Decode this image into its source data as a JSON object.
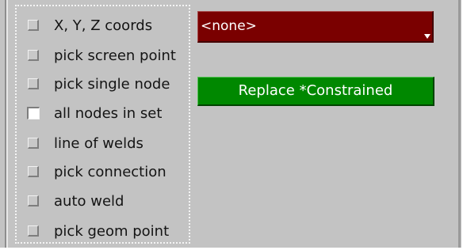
{
  "options": [
    {
      "label": "X, Y, Z coords",
      "checked": false
    },
    {
      "label": "pick screen point",
      "checked": false
    },
    {
      "label": "pick single node",
      "checked": false
    },
    {
      "label": "all nodes in set",
      "checked": true
    },
    {
      "label": "line of welds",
      "checked": false
    },
    {
      "label": "pick connection",
      "checked": false
    },
    {
      "label": "auto weld",
      "checked": false
    },
    {
      "label": "pick geom point",
      "checked": false
    }
  ],
  "dropdown": {
    "value": "<none>",
    "color": "#7a0000"
  },
  "replace_button": {
    "label": "Replace *Constrained",
    "color": "#008800"
  },
  "colors": {
    "panel_background": "#c3c3c3",
    "text": "#141414"
  }
}
